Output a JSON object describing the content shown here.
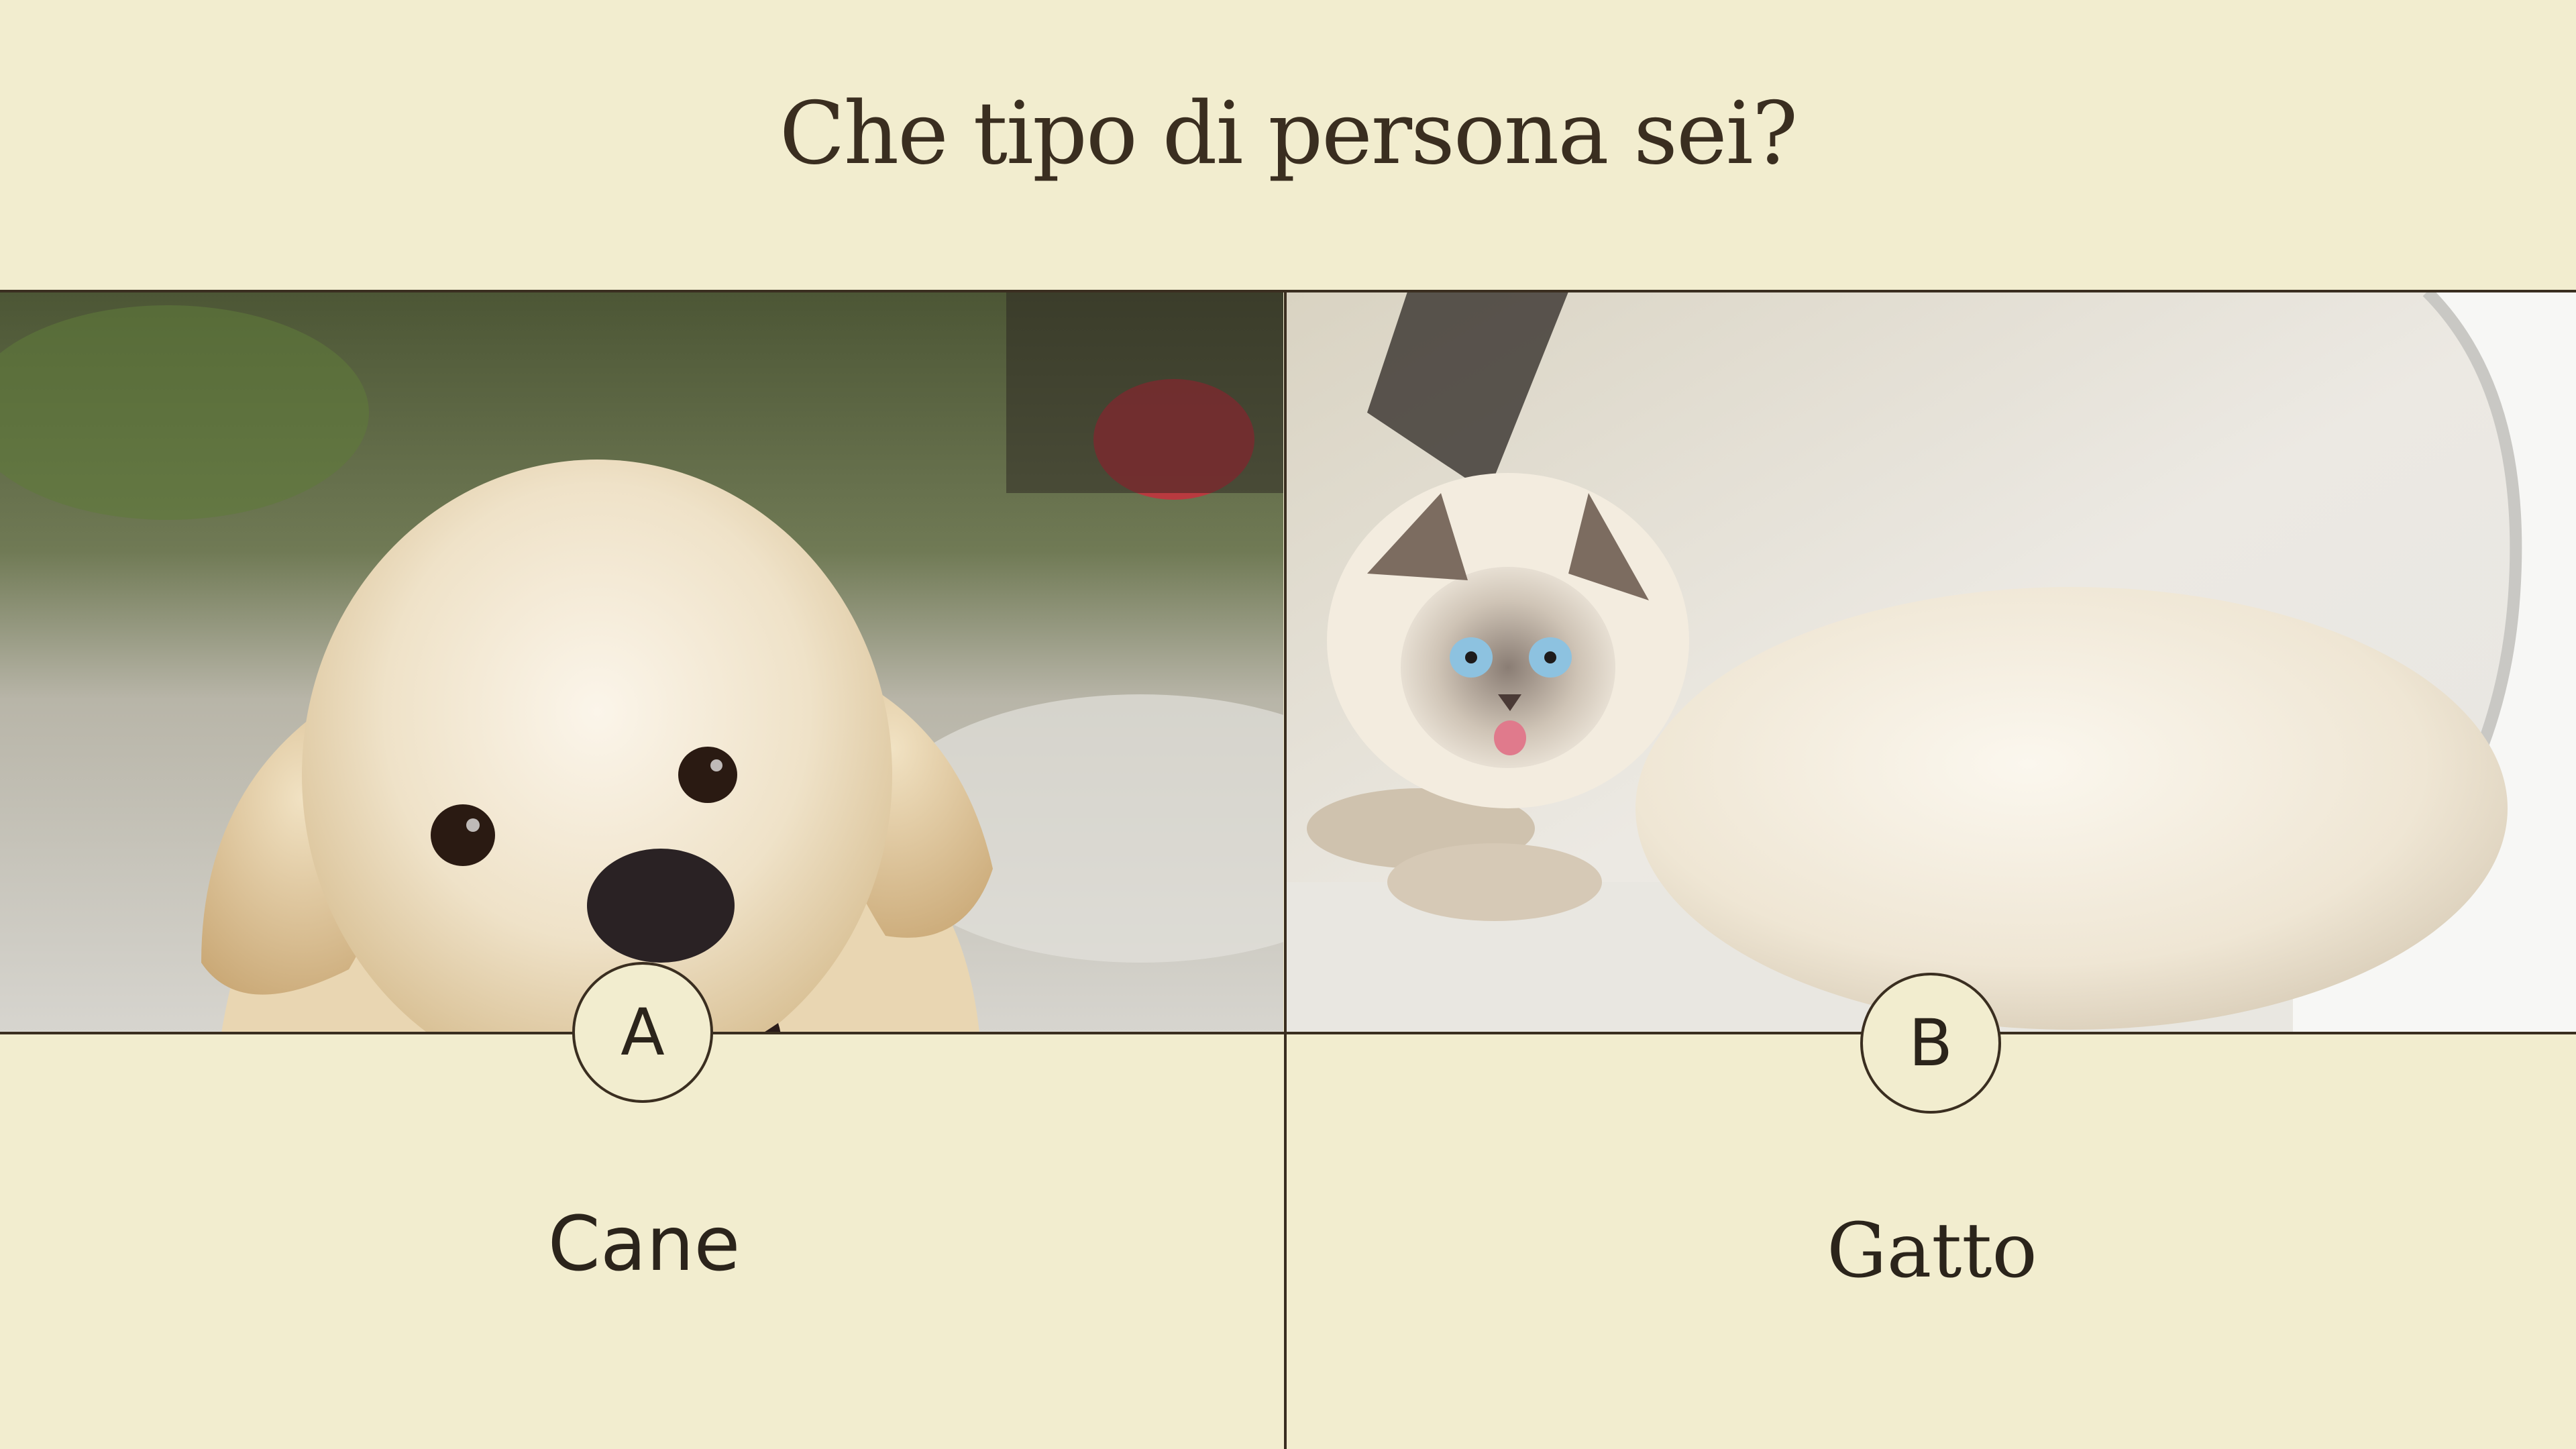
{
  "title": "Che tipo di persona sei?",
  "options": [
    {
      "letter": "A",
      "label": "Cane",
      "image": "golden-retriever-photo"
    },
    {
      "letter": "B",
      "label": "Gatto",
      "image": "white-cat-photo"
    }
  ],
  "colors": {
    "background": "#f2edcf",
    "line": "#3a2e20",
    "text": "#2b241b"
  }
}
